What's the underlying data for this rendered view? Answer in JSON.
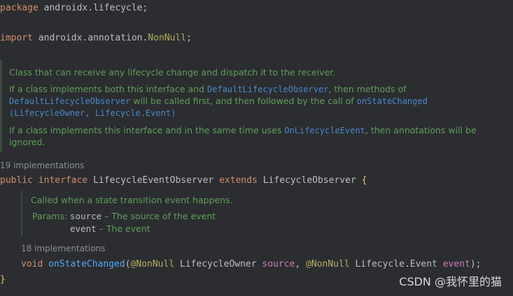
{
  "code": {
    "package_kw": "package",
    "package_name": "androidx.lifecycle",
    "package_semi": ";",
    "import_kw": "import",
    "import_name": "androidx.annotation.",
    "import_class": "NonNull",
    "import_semi": ";",
    "iface_public": "public",
    "iface_interface": "interface",
    "iface_name": "LifecycleEventObserver",
    "iface_extends": "extends",
    "iface_parent": "LifecycleObserver",
    "iface_brace": "{",
    "method_void": "void",
    "method_name": "onStateChanged",
    "method_open": "(",
    "method_ann1": "@NonNull",
    "method_type1": "LifecycleOwner",
    "method_param1": "source",
    "method_comma": ",",
    "method_ann2": "@NonNull",
    "method_type2": "Lifecycle.Event",
    "method_param2": "event",
    "method_close": ");",
    "close_brace": "}"
  },
  "class_doc": {
    "line1": "Class that can receive any lifecycle change and dispatch it to the receiver.",
    "p2_a": "If a class implements both this interface and ",
    "p2_link1": "DefaultLifecycleObserver",
    "p2_b": ", then methods of",
    "p2_link2": "DefaultLifecycleObserver",
    "p2_c": " will be called first, and then followed by the call of ",
    "p2_link3": "onStateChanged",
    "p2_link4": "(LifecycleOwner, Lifecycle.Event)",
    "p3_a": "If a class implements this interface and in the same time uses ",
    "p3_link": "OnLifecycleEvent",
    "p3_b": ", then annotations will be",
    "p3_c": "ignored."
  },
  "hints": {
    "iface_impl": "19 implementations",
    "method_impl": "18 implementations"
  },
  "method_doc": {
    "summary": "Called when a state transition event happens.",
    "params_label": "Params:",
    "param1_name": "source",
    "param1_desc": " – The source of the event",
    "param2_name": "event",
    "param2_desc": " – The event"
  },
  "watermark": "CSDN @我怀里的猫"
}
